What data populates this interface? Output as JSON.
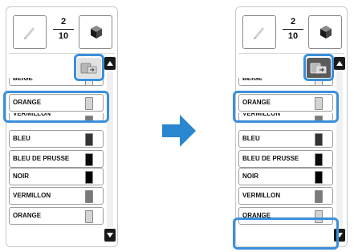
{
  "left_panel": {
    "fraction": {
      "numerator": "2",
      "denominator": "10"
    },
    "list": [
      {
        "label": "BEIGE",
        "color": "#eeeeee"
      },
      {
        "label": "ORANGE",
        "color": "#d4d4d4"
      },
      {
        "label": "VERMILLON",
        "color": "#7a7a7a"
      },
      {
        "label": "BLEU",
        "color": "#333333"
      },
      {
        "label": "BLEU DE PRUSSE",
        "color": "#0a0a0a"
      },
      {
        "label": "NOIR",
        "color": "#000000"
      },
      {
        "label": "VERMILLON",
        "color": "#7a7a7a"
      },
      {
        "label": "ORANGE",
        "color": "#d4d4d4"
      }
    ]
  },
  "right_panel": {
    "fraction": {
      "numerator": "2",
      "denominator": "10"
    },
    "list": [
      {
        "label": "BEIGE",
        "color": "#eeeeee"
      },
      {
        "label": "ORANGE",
        "color": "#d4d4d4"
      },
      {
        "label": "VERMILLON",
        "color": "#7a7a7a"
      },
      {
        "label": "BLEU",
        "color": "#333333"
      },
      {
        "label": "BLEU DE PRUSSE",
        "color": "#0a0a0a"
      },
      {
        "label": "NOIR",
        "color": "#000000"
      },
      {
        "label": "VERMILLON",
        "color": "#7a7a7a"
      },
      {
        "label": "ORANGE",
        "color": "#d4d4d4"
      }
    ]
  },
  "colors": {
    "highlight": "#3a8fdc",
    "arrow": "#2a86cf",
    "swap_button_idle": "#e2e2e2",
    "swap_button_active": "#5b5b5b"
  },
  "icons": {
    "thumb": "pen-nib-icon",
    "cube": "cube-icon",
    "swap": "spool-swap-icon",
    "arrow": "arrow-right-icon"
  }
}
